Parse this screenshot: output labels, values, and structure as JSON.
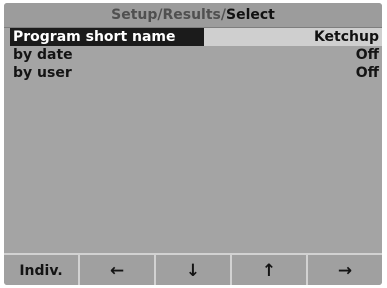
{
  "header": {
    "path_part1": "Setup/",
    "path_part2": "Results/",
    "path_part3": "Select"
  },
  "rows": [
    {
      "label": "Program short name",
      "value": "Ketchup",
      "selected": true
    },
    {
      "label": "by date",
      "value": "Off",
      "selected": false
    },
    {
      "label": "by user",
      "value": "Off",
      "selected": false
    }
  ],
  "softkeys": {
    "indiv_label": "Indiv.",
    "left_icon": "left-arrow-icon",
    "left_glyph": "←",
    "down_icon": "down-arrow-icon",
    "down_glyph": "↓",
    "up_icon": "up-arrow-icon",
    "up_glyph": "↑",
    "right_icon": "right-arrow-icon",
    "right_glyph": "→"
  },
  "colors": {
    "screen_bg": "#a4a4a4",
    "selected_label_bg": "#1b1b1b",
    "selected_value_bg": "#cfcfcf"
  }
}
